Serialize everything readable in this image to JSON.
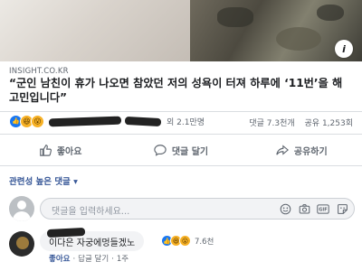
{
  "post": {
    "source": "INSIGHT.CO.KR",
    "headline": "“군인 남친이 휴가 나오면 참았던 저의 성욕이 터져 하루에 ‘11번’을 해 고민입니다”"
  },
  "reactions": {
    "icons": [
      "like-icon",
      "haha-icon",
      "wow-icon"
    ],
    "others_text": "외 2.1만명",
    "comments": "댓글 7.3천개",
    "shares": "공유 1,253회"
  },
  "actions": {
    "like": "좋아요",
    "comment": "댓글 달기",
    "share": "공유하기"
  },
  "comments_section": {
    "filter": "관련성 높은 댓글 ▾",
    "input_placeholder": "댓글을 입력하세요...",
    "input_icons": [
      "emoji-icon",
      "camera-icon",
      "gif-icon",
      "sticker-icon"
    ]
  },
  "top_comment": {
    "text": "이다은 자궁에멍들겠노",
    "reaction_count": "7.6천",
    "like_label": "좋아요",
    "reply_label": "답글 달기",
    "time": "1주"
  }
}
